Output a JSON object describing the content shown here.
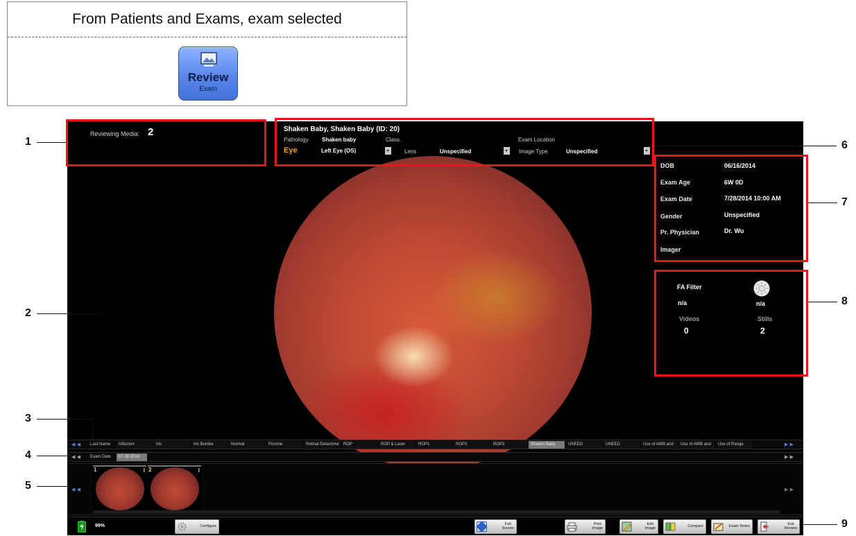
{
  "instruction": {
    "title": "From Patients and Exams, exam selected",
    "button": {
      "main": "Review",
      "sub": "Exam",
      "icon": "image-review-icon"
    }
  },
  "top_left": {
    "label": "Reviewing Media:",
    "value": "2"
  },
  "patient": {
    "name": "Shaken Baby, Shaken Baby (ID: 20)",
    "pathology_label": "Pathology",
    "pathology_value": "Shaken baby",
    "class_label": "Class.",
    "exam_location_label": "Exam Location",
    "eye_label": "Eye",
    "eye_value": "Left Eye (OS)",
    "lens_label": "Lens",
    "lens_value": "Unspecified",
    "image_type_label": "Image Type",
    "image_type_value": "Unspecified"
  },
  "details": [
    {
      "label": "DOB",
      "value": "06/16/2014"
    },
    {
      "label": "Exam Age",
      "value": "6W 0D"
    },
    {
      "label": "Exam Date",
      "value": "7/28/2014 10:00 AM"
    },
    {
      "label": "Gender",
      "value": "Unspecified"
    },
    {
      "label": "Pr. Physician",
      "value": "Dr. Wu"
    },
    {
      "label": "Imager",
      "value": ""
    }
  ],
  "fa": {
    "filter_label": "FA Filter",
    "filter_value": "n/a",
    "light_value": "n/a",
    "videos_label": "Videos",
    "videos_value": "0",
    "stills_label": "Stills",
    "stills_value": "2"
  },
  "name_strip": {
    "label": "Last Name",
    "items": [
      "Infection",
      "Iris",
      "Iris Bombe",
      "Normal",
      "Porcine",
      "Retinal Detachme",
      "ROP",
      "ROP & Laser",
      "ROP1",
      "ROP2",
      "ROP3",
      "Shaken Baby",
      "UNEED",
      "UNEED",
      "Use of AWB and",
      "Use of AWB and",
      "Use of Range"
    ],
    "selected": "Shaken Baby"
  },
  "date_strip": {
    "label": "Exam Date",
    "items": [
      "07 28 2014"
    ]
  },
  "thumbnails": [
    {
      "num": "1"
    },
    {
      "num": "2"
    }
  ],
  "toolbar": {
    "battery": "99%",
    "configure": "Configure",
    "full_screen": "Full\nScreen",
    "print_image": "Print\nImage",
    "edit_image": "Edit\nImage",
    "compare": "Compare",
    "exam_notes": "Exam Notes",
    "exit_review": "Exit\nReview"
  },
  "callouts": [
    "1",
    "2",
    "3",
    "4",
    "5",
    "6",
    "7",
    "8",
    "9"
  ],
  "colors": {
    "callout_red": "#e8161b",
    "eye_label": "#f0a020",
    "screen_bg": "#000000"
  }
}
